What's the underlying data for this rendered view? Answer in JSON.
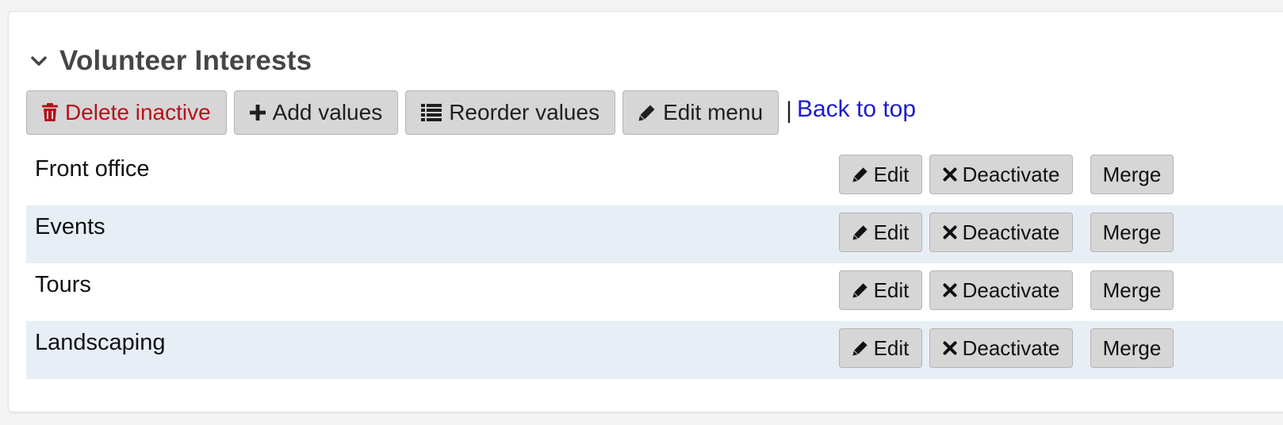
{
  "section": {
    "title": "Volunteer Interests"
  },
  "toolbar": {
    "delete_inactive": "Delete inactive",
    "add_values": "Add values",
    "reorder_values": "Reorder values",
    "edit_menu": "Edit menu",
    "separator": "|",
    "back_to_top": "Back to top"
  },
  "row_actions": {
    "edit": "Edit",
    "deactivate": "Deactivate",
    "merge": "Merge"
  },
  "rows": [
    {
      "label": "Front office"
    },
    {
      "label": "Events"
    },
    {
      "label": "Tours"
    },
    {
      "label": "Landscaping"
    }
  ],
  "colors": {
    "danger": "#b5121b",
    "link": "#1c1ccc",
    "alt_row": "#e8eef6",
    "button_bg": "#d6d6d6"
  }
}
